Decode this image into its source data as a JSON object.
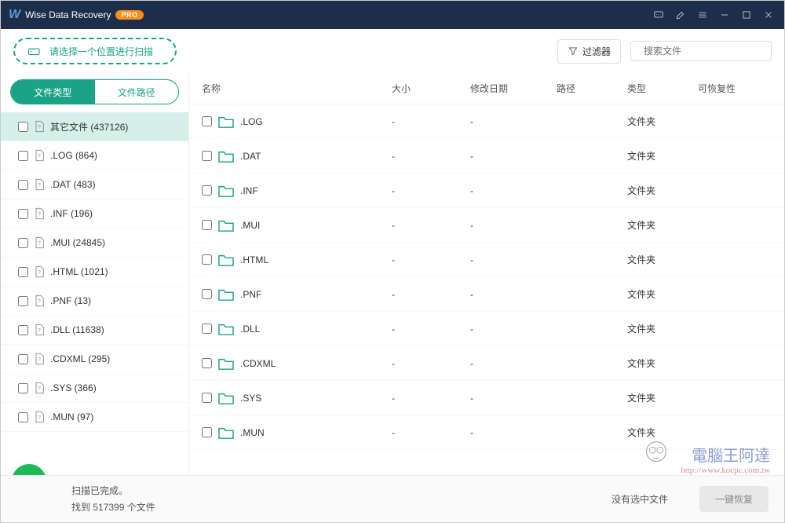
{
  "titlebar": {
    "title": "Wise Data Recovery",
    "pro": "PRO"
  },
  "toolbar": {
    "scan_prompt": "请选择一个位置进行扫描",
    "filter_label": "过滤器",
    "search_placeholder": "搜索文件"
  },
  "sidebar": {
    "tab_type": "文件类型",
    "tab_path": "文件路径",
    "items": [
      {
        "label": "其它文件 (437126)",
        "selected": true
      },
      {
        "label": ".LOG (864)"
      },
      {
        "label": ".DAT (483)"
      },
      {
        "label": ".INF (196)"
      },
      {
        "label": ".MUI (24845)"
      },
      {
        "label": ".HTML (1021)"
      },
      {
        "label": ".PNF (13)"
      },
      {
        "label": ".DLL (11638)"
      },
      {
        "label": ".CDXML (295)"
      },
      {
        "label": ".SYS (366)"
      },
      {
        "label": ".MUN (97)"
      }
    ]
  },
  "table": {
    "headers": {
      "name": "名称",
      "size": "大小",
      "date": "修改日期",
      "path": "路径",
      "type": "类型",
      "recov": "可恢复性"
    },
    "rows": [
      {
        "name": ".LOG",
        "size": "-",
        "date": "-",
        "path": "",
        "type": "文件夹"
      },
      {
        "name": ".DAT",
        "size": "-",
        "date": "-",
        "path": "",
        "type": "文件夹"
      },
      {
        "name": ".INF",
        "size": "-",
        "date": "-",
        "path": "",
        "type": "文件夹"
      },
      {
        "name": ".MUI",
        "size": "-",
        "date": "-",
        "path": "",
        "type": "文件夹"
      },
      {
        "name": ".HTML",
        "size": "-",
        "date": "-",
        "path": "",
        "type": "文件夹"
      },
      {
        "name": ".PNF",
        "size": "-",
        "date": "-",
        "path": "",
        "type": "文件夹"
      },
      {
        "name": ".DLL",
        "size": "-",
        "date": "-",
        "path": "",
        "type": "文件夹"
      },
      {
        "name": ".CDXML",
        "size": "-",
        "date": "-",
        "path": "",
        "type": "文件夹"
      },
      {
        "name": ".SYS",
        "size": "-",
        "date": "-",
        "path": "",
        "type": "文件夹"
      },
      {
        "name": ".MUN",
        "size": "-",
        "date": "-",
        "path": "",
        "type": "文件夹"
      }
    ]
  },
  "status": {
    "line1": "扫描已完成。",
    "line2": "找到 517399 个文件",
    "selection": "没有选中文件",
    "recover_btn": "一键恢复"
  },
  "watermark": {
    "text": "電腦王阿達",
    "url": "http://www.kocpc.com.tw"
  }
}
